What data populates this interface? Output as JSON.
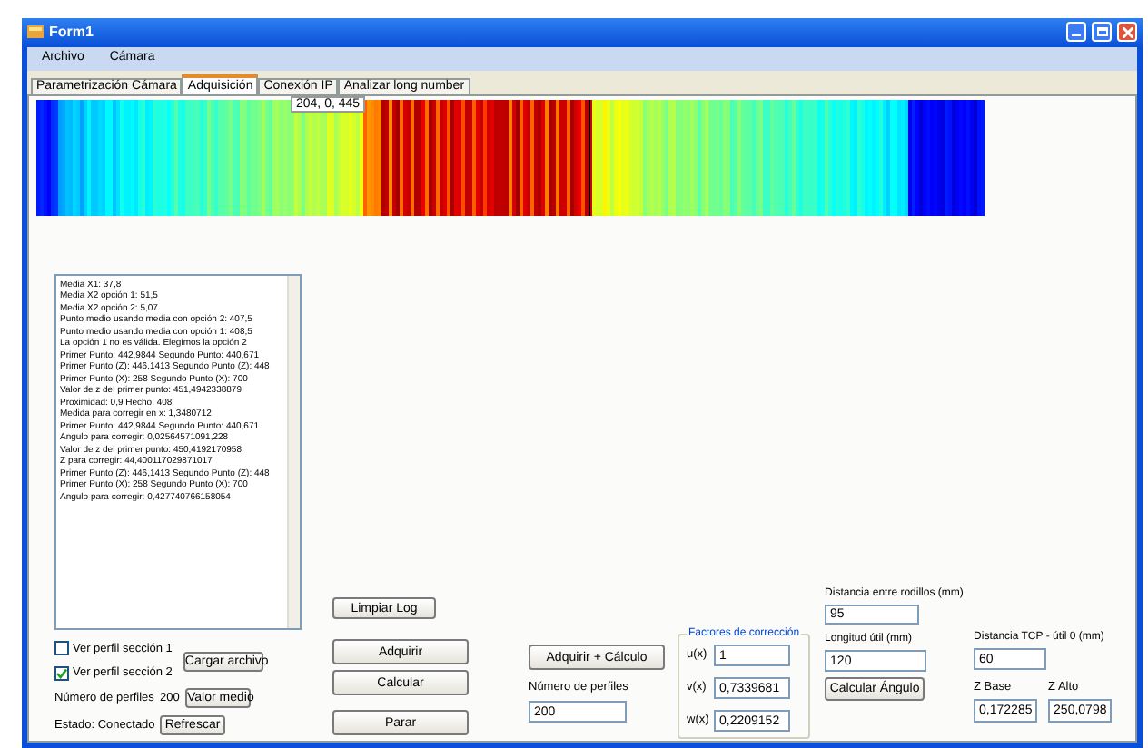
{
  "window": {
    "title": "Form1"
  },
  "menu": [
    "Archivo",
    "Cámara"
  ],
  "tabs": [
    {
      "label": "Parametrización Cámara",
      "selected": false
    },
    {
      "label": "Adquisición",
      "selected": true
    },
    {
      "label": "Conexión IP",
      "selected": false
    },
    {
      "label": "Analizar long number",
      "selected": false
    }
  ],
  "image_tooltip": "204, 0, 445",
  "log": [
    "Media X1: 37,8",
    "Media X2 opción 1: 51,5",
    "Media X2 opción 2: 5,07",
    "Punto medio usando media con opción 2: 407,5",
    "Punto medio usando media con opción 1: 408,5",
    "La opción 1 no es válida. Elegimos la opción 2",
    "Primer Punto: 442,9844 Segundo Punto: 440,671",
    "Primer Punto (Z): 446,1413 Segundo Punto (Z): 448",
    "Primer Punto (X): 258 Segundo Punto (X): 700",
    "Valor de z del primer punto: 451,4942338879",
    "Proximidad: 0,9 Hecho: 408",
    "Medida para corregir en x: 1,3480712",
    "Primer Punto: 442,9844 Segundo Punto: 440,671",
    "Angulo para corregir: 0,02564571091,228",
    "Valor de z del primer punto: 450,4192170958",
    "Z para corregir: 44,400117029871017",
    "Primer Punto (Z): 446,1413 Segundo Punto (Z): 448",
    "Primer Punto (X): 258 Segundo Punto (X): 700",
    "Angulo para corregir: 0,427740766158054"
  ],
  "checkboxes": [
    {
      "label": "Ver perfil sección 1",
      "checked": false
    },
    {
      "label": "Ver perfil sección 2",
      "checked": true
    }
  ],
  "load_button": "Cargar archivo",
  "profiles_label": "Número de perfiles",
  "profiles_value": "200",
  "mean_button": "Valor medio",
  "status": "Estado: Conectado",
  "refresh_button": "Refrescar",
  "clear_log_button": "Limpiar Log",
  "action_buttons": [
    "Adquirir",
    "Calcular",
    "Parar"
  ],
  "acquire_calc_button": "Adquirir + Cálculo",
  "num_profiles": {
    "label": "Número de perfiles",
    "value": "200"
  },
  "correction": {
    "title": "Factores de corrección",
    "rows": [
      {
        "label": "u(x)",
        "value": "1"
      },
      {
        "label": "v(x)",
        "value": "0,7339681"
      },
      {
        "label": "w(x)",
        "value": "0,2209152"
      }
    ]
  },
  "roller_distance": {
    "label": "Distancia entre rodillos (mm)",
    "value": "95"
  },
  "useful_length": {
    "label": "Longitud útil (mm)",
    "value": "120"
  },
  "angle_button": "Calcular Ángulo",
  "tcp_distance": {
    "label": "Distancia TCP - útil 0 (mm)",
    "value": "60"
  },
  "z_fields": [
    {
      "label": "Z Base",
      "value": "0,172285"
    },
    {
      "label": "Z Alto",
      "value": "250,0798"
    }
  ]
}
